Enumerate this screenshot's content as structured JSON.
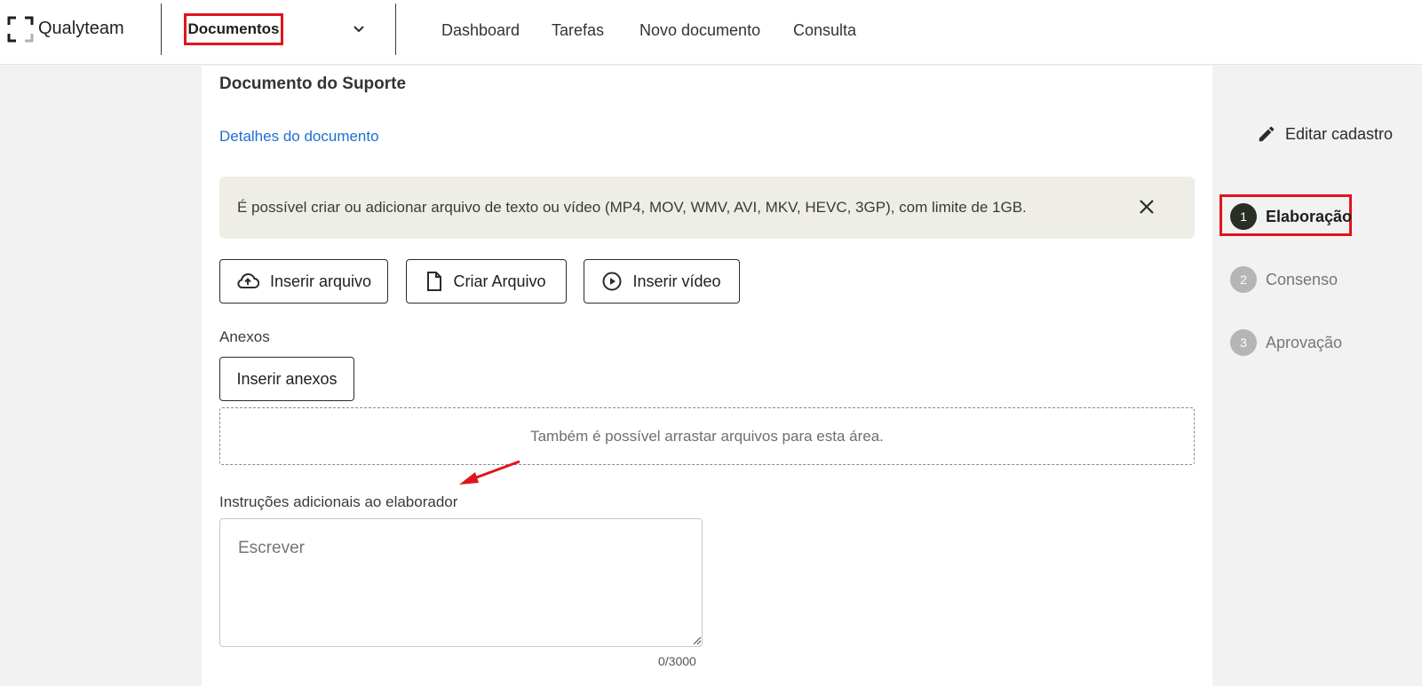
{
  "header": {
    "logo_text": "Qualyteam",
    "module": "Documentos",
    "nav": [
      "Dashboard",
      "Tarefas",
      "Novo documento",
      "Consulta"
    ]
  },
  "document": {
    "title": "Documento do Suporte",
    "details_link": "Detalhes do documento",
    "edit_label": "Editar cadastro"
  },
  "alert": {
    "text": "É possível criar ou adicionar arquivo de texto ou vídeo (MP4, MOV, WMV, AVI, MKV, HEVC, 3GP), com limite de 1GB."
  },
  "actions": {
    "insert_file": "Inserir arquivo",
    "create_file": "Criar Arquivo",
    "insert_video": "Inserir vídeo"
  },
  "attachments": {
    "label": "Anexos",
    "button": "Inserir anexos",
    "dropzone": "Também é possível arrastar arquivos para esta área."
  },
  "instructions": {
    "label": "Instruções adicionais ao elaborador",
    "placeholder": "Escrever",
    "counter": "0/3000"
  },
  "steps": [
    {
      "number": "1",
      "label": "Elaboração",
      "state": "active"
    },
    {
      "number": "2",
      "label": "Consenso",
      "state": "pending"
    },
    {
      "number": "3",
      "label": "Aprovação",
      "state": "pending"
    }
  ],
  "colors": {
    "accent_link": "#1f6fcf",
    "highlight_red": "#e0141e",
    "step_active": "#2a2f24",
    "step_pending": "#b5b5b5",
    "alert_bg": "#eeeee6"
  }
}
